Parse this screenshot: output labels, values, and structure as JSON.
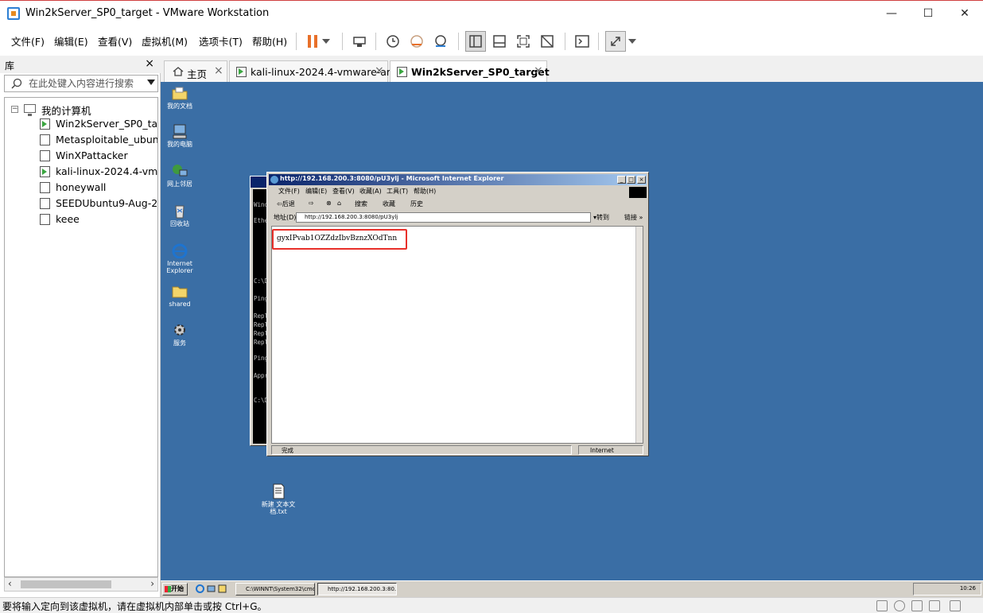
{
  "window": {
    "title": "Win2kServer_SP0_target - VMware Workstation",
    "minimize": "—",
    "maximize": "☐",
    "close": "✕"
  },
  "menu": {
    "file": "文件(F)",
    "edit": "编辑(E)",
    "view": "查看(V)",
    "vm": "虚拟机(M)",
    "tabs": "选项卡(T)",
    "help": "帮助(H)"
  },
  "library": {
    "title": "库",
    "close": "×",
    "search_placeholder": "在此处键入内容进行搜索",
    "root": "我的计算机",
    "vms": [
      {
        "label": "Win2kServer_SP0_targ",
        "running": true
      },
      {
        "label": "Metasploitable_ubunt",
        "running": false
      },
      {
        "label": "WinXPattacker",
        "running": false
      },
      {
        "label": "kali-linux-2024.4-vmw",
        "running": true
      },
      {
        "label": "honeywall",
        "running": false
      },
      {
        "label": "SEEDUbuntu9-Aug-20",
        "running": false
      },
      {
        "label": "keee",
        "running": false
      }
    ]
  },
  "tabs": [
    {
      "label": "主页",
      "close": "×"
    },
    {
      "label": "kali-linux-2024.4-vmware-am...",
      "close": "×"
    },
    {
      "label": "Win2kServer_SP0_target",
      "close": "×"
    }
  ],
  "desktop_icons": [
    "我的文档",
    "我的电脑",
    "网上邻居",
    "回收站",
    "Internet Explorer",
    "shared",
    "服务",
    "新建 文本文档.txt"
  ],
  "cmd": {
    "lines": [
      "Wind",
      "Ethe",
      "C:\\D",
      "Ping",
      "Repl",
      "Repl",
      "Repl",
      "Repl",
      "Ping",
      "Appr",
      "C:\\D"
    ]
  },
  "ie": {
    "title": "http://192.168.200.3:8080/pU3ylj - Microsoft Internet Explorer",
    "menus": [
      "文件(F)",
      "编辑(E)",
      "查看(V)",
      "收藏(A)",
      "工具(T)",
      "帮助(H)"
    ],
    "toolbar": [
      "⇦后退",
      "⇨",
      "⊗",
      "⌂",
      "搜索",
      "收藏",
      "历史"
    ],
    "address_label": "地址(D)",
    "address": "http://192.168.200.3:8080/pU3ylj",
    "go": "▾转到",
    "links": "链接 »",
    "page_text": "gyxIPvab1OZZdzIbvBznzXOdTnn",
    "status": "完成",
    "zone": "Internet"
  },
  "taskbar": {
    "start": "开始",
    "tasks": [
      "C:\\WINNT\\System32\\cmd....",
      "http://192.168.200.3:80..."
    ],
    "clock": "10:26"
  },
  "statusbar": {
    "text": "要将输入定向到该虚拟机，请在虚拟机内部单击或按 Ctrl+G。"
  },
  "colors": {
    "vm_desktop": "#3a6ea5",
    "highlight_box": "#e8302a",
    "running_vm": "#3aa640"
  }
}
